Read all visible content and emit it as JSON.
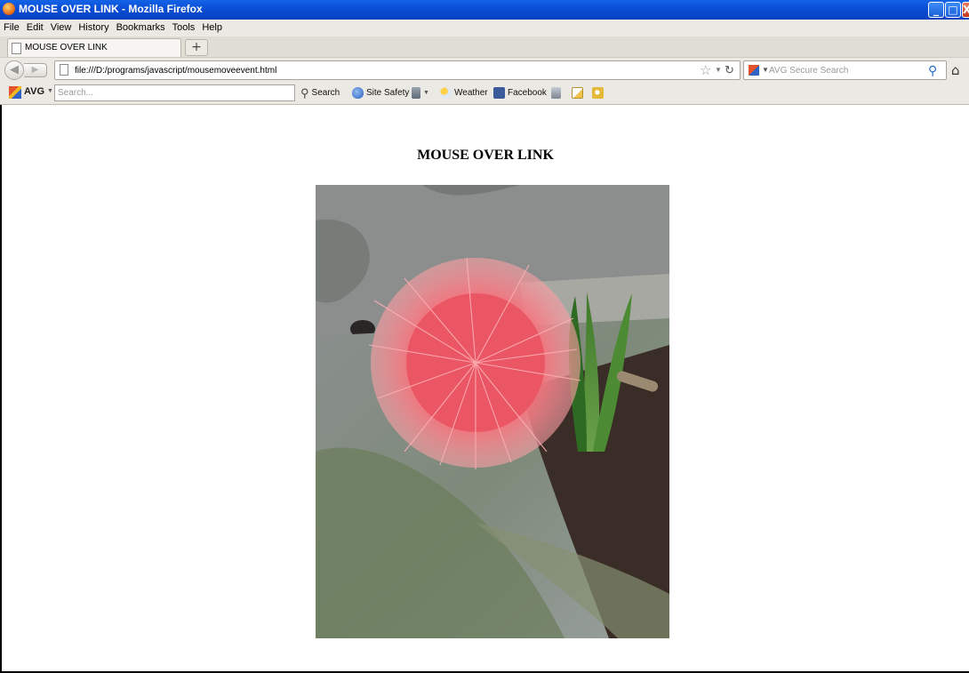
{
  "window": {
    "title": "MOUSE OVER LINK - Mozilla Firefox",
    "controls": {
      "minimize": "_",
      "maximize": "□",
      "close": "X"
    }
  },
  "menu": [
    "File",
    "Edit",
    "View",
    "History",
    "Bookmarks",
    "Tools",
    "Help"
  ],
  "tabs": [
    {
      "label": "MOUSE OVER LINK"
    }
  ],
  "new_tab": "+",
  "nav": {
    "url": "file:///D:/programs/javascript/mousemoveevent.html",
    "search_placeholder": "AVG Secure Search"
  },
  "avg_toolbar": {
    "brand": "AVG",
    "search_placeholder": "Search...",
    "buttons": [
      "Search",
      "Site Safety",
      "Weather",
      "Facebook"
    ]
  },
  "page": {
    "heading": "MOUSE OVER LINK",
    "image": "flower-photo"
  }
}
